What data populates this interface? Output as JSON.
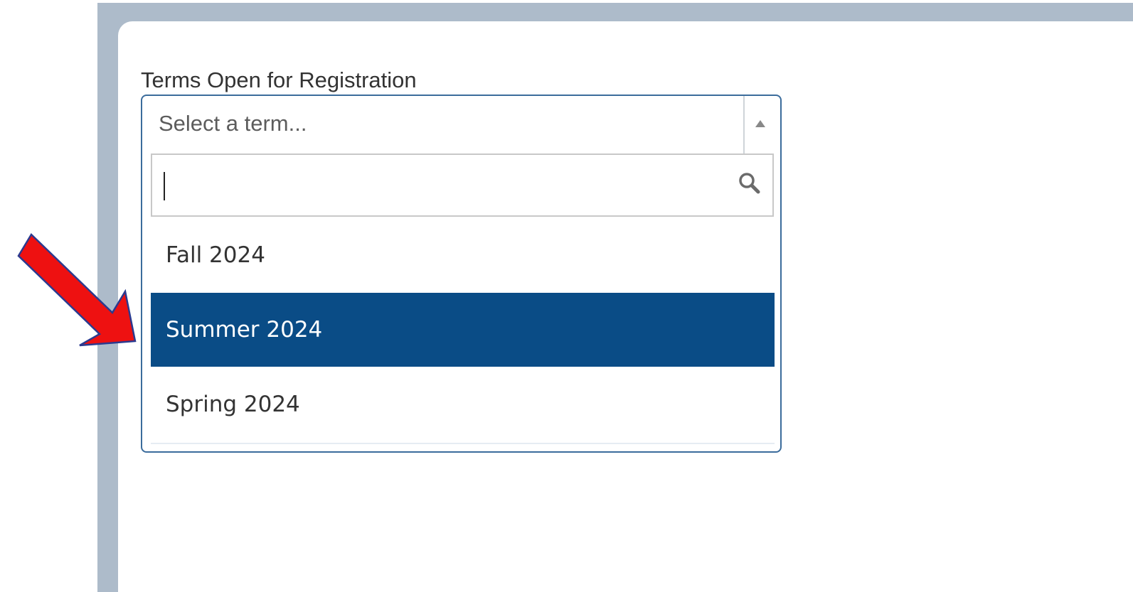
{
  "form": {
    "field_label": "Terms Open for Registration"
  },
  "term_select": {
    "placeholder": "Select a term...",
    "search": {
      "value": "",
      "icon": "search-icon"
    },
    "options": [
      {
        "label": "Fall 2024",
        "selected": false
      },
      {
        "label": "Summer 2024",
        "selected": true
      },
      {
        "label": "Spring 2024",
        "selected": false
      }
    ],
    "state": "open"
  },
  "colors": {
    "frame": "#adbbca",
    "select_border": "#3b6c9c",
    "selected_option_bg": "#0a4c86",
    "annotation_arrow": "#ee1111"
  },
  "annotation": {
    "type": "arrow",
    "color": "red",
    "points_to": "Summer 2024"
  }
}
